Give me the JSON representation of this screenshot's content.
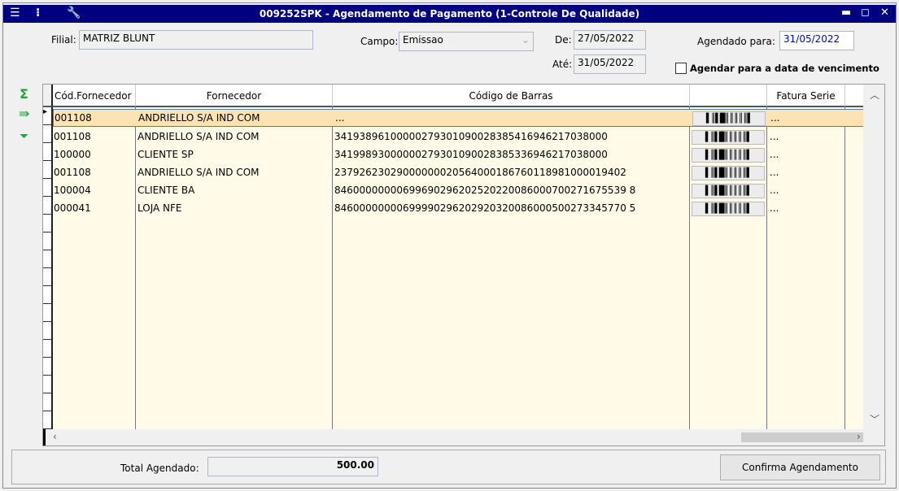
{
  "window": {
    "title": "009252SPK - Agendamento de Pagamento (1-Controle De Qualidade)",
    "icons": [
      "menu-icon",
      "traffic-light-icon",
      "wrench-icon"
    ],
    "title_bar_color": "#000080"
  },
  "filters": {
    "filial_label": "Filial:",
    "filial_value": "MATRIZ BLUNT",
    "campo_label": "Campo:",
    "campo_value": "Emissao",
    "de_label": "De:",
    "de_value": "27/05/2022",
    "ate_label": "Até:",
    "ate_value": "31/05/2022",
    "agendado_label": "Agendado para:",
    "agendado_value": "31/05/2022",
    "checkbox_label": "Agendar para a data de vencimento",
    "checkbox_checked": false
  },
  "grid": {
    "columns": [
      "Cód.Fornecedor",
      "Fornecedor",
      "Código de Barras",
      "",
      "Fatura Serie"
    ],
    "rows": [
      {
        "cod": "001108",
        "fornecedor": "ANDRIELLO S/A IND COM",
        "barras": "...",
        "fatura": "...",
        "selected": true
      },
      {
        "cod": "001108",
        "fornecedor": "ANDRIELLO S/A IND COM",
        "barras": "34193896100000279301090028385416946217038000",
        "fatura": "..."
      },
      {
        "cod": "100000",
        "fornecedor": "CLIENTE SP",
        "barras": "34199893000000279301090028385336946217038000",
        "fatura": "..."
      },
      {
        "cod": "001108",
        "fornecedor": "ANDRIELLO S/A IND COM",
        "barras": "23792623029000000020564000186760118981000019402",
        "fatura": "..."
      },
      {
        "cod": "100004",
        "fornecedor": "CLIENTE BA",
        "barras": "84600000000699690296202520220086000700271675539 8",
        "fatura": "..."
      },
      {
        "cod": "000041",
        "fornecedor": "LOJA NFE",
        "barras": "84600000000699990296202920320086000500273345770 5",
        "fatura": "..."
      }
    ],
    "barcode_glyph": "▌║▌█║║║║║▌",
    "selected_color": "#fde2b4"
  },
  "footer": {
    "total_label": "Total Agendado:",
    "total_value": "500.00",
    "confirm_label": "Confirma Agendamento"
  },
  "side_icons": [
    "sum-icon",
    "export-icon",
    "filter-icon"
  ]
}
